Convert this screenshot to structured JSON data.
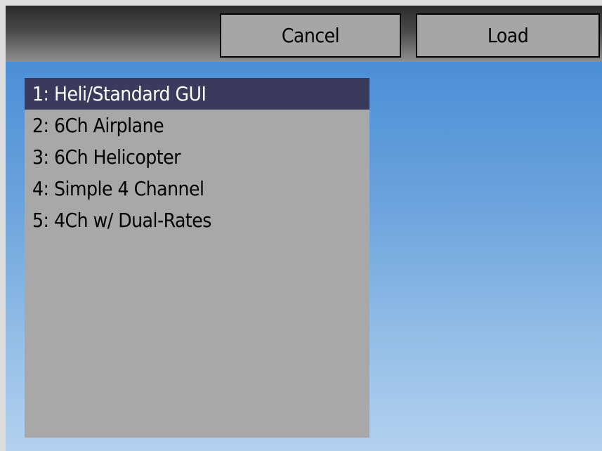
{
  "toolbar": {
    "cancel_label": "Cancel",
    "load_label": "Load"
  },
  "model_list": {
    "selected_index": 0,
    "items": [
      {
        "label": "1: Heli/Standard GUI"
      },
      {
        "label": "2: 6Ch Airplane"
      },
      {
        "label": "3: 6Ch Helicopter"
      },
      {
        "label": "4: Simple 4 Channel"
      },
      {
        "label": "5: 4Ch w/ Dual-Rates"
      }
    ]
  },
  "colors": {
    "selection_bg": "#3b3a5c",
    "list_bg": "#a8a8a8",
    "button_bg": "#a6a6a6",
    "background_top": "#4b8fd6",
    "background_bottom": "#b3d1ef"
  }
}
